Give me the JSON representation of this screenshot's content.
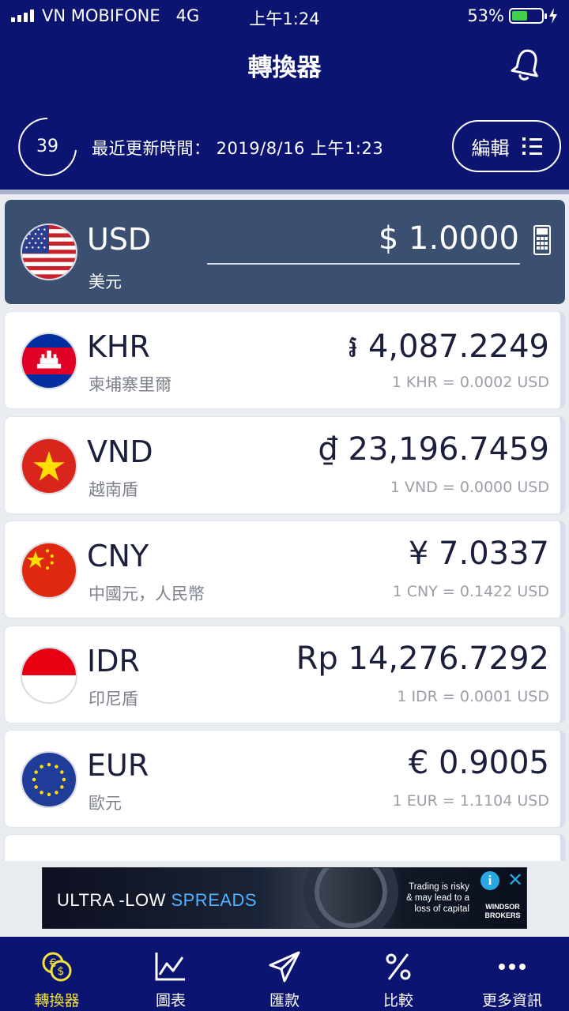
{
  "status_bar": {
    "carrier": "VN MOBIFONE",
    "network": "4G",
    "time": "上午1:24",
    "battery": "53%",
    "battery_level": 0.53
  },
  "header": {
    "title": "轉換器",
    "refresh_count": "39",
    "updated_label": "最近更新時間： 2019/8/16 上午1:23",
    "edit_label": "編輯"
  },
  "base": {
    "code": "USD",
    "name": "美元",
    "amount": "$ 1.0000"
  },
  "currencies": [
    {
      "code": "KHR",
      "name": "柬埔寨里爾",
      "value": "៛ 4,087.2249",
      "rate": "1 KHR = 0.0002 USD"
    },
    {
      "code": "VND",
      "name": "越南盾",
      "value": "₫ 23,196.7459",
      "rate": "1 VND = 0.0000 USD"
    },
    {
      "code": "CNY",
      "name": "中國元，人民幣",
      "value": "¥ 7.0337",
      "rate": "1 CNY = 0.1422 USD"
    },
    {
      "code": "IDR",
      "name": "印尼盾",
      "value": "Rp 14,276.7292",
      "rate": "1 IDR = 0.0001 USD"
    },
    {
      "code": "EUR",
      "name": "歐元",
      "value": "€ 0.9005",
      "rate": "1 EUR = 1.1104 USD"
    }
  ],
  "ad": {
    "headline_a": "ULTRA -LOW ",
    "headline_b": "SPREADS",
    "risk_text": "Trading is risky & may lead to a loss of capital",
    "brand": "WINDSOR BROKERS"
  },
  "nav": [
    {
      "label": "轉換器",
      "icon": "currency-exchange-icon",
      "active": true
    },
    {
      "label": "圖表",
      "icon": "chart-icon",
      "active": false
    },
    {
      "label": "匯款",
      "icon": "send-icon",
      "active": false
    },
    {
      "label": "比較",
      "icon": "percent-icon",
      "active": false
    },
    {
      "label": "更多資訊",
      "icon": "more-icon",
      "active": false
    }
  ],
  "colors": {
    "navy": "#0c1472",
    "base_card": "#3b5070",
    "active_nav": "#f0e23a",
    "battery": "#42d14a"
  }
}
